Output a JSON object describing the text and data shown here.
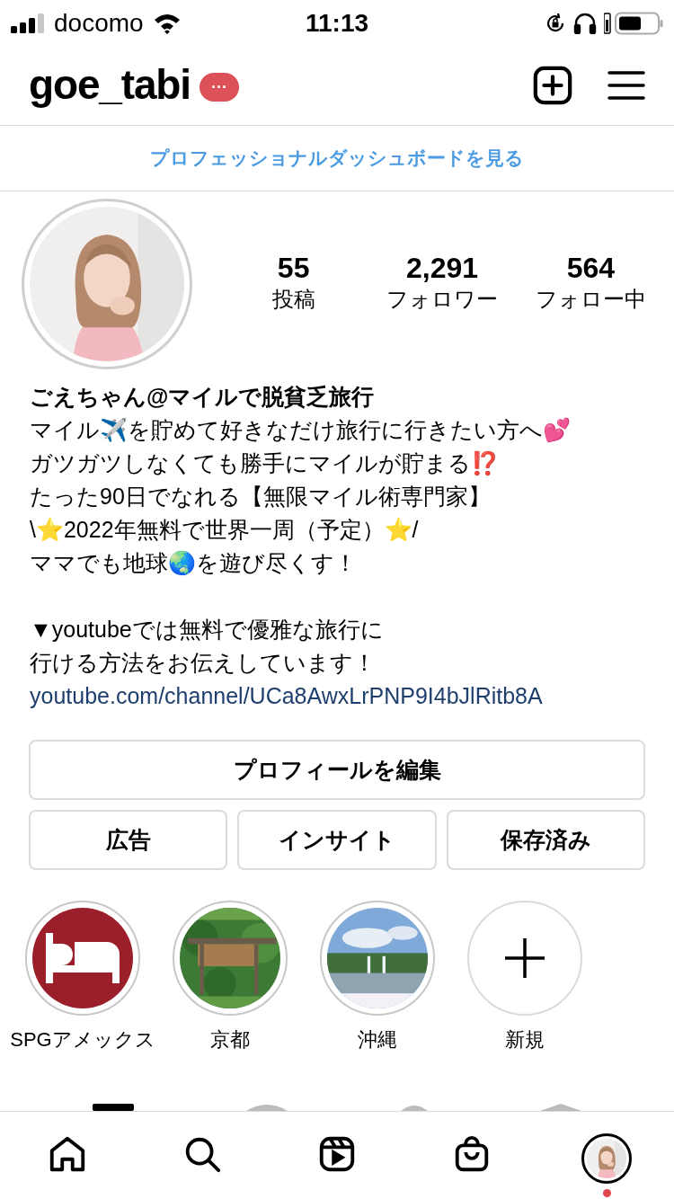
{
  "status_bar": {
    "carrier": "docomo",
    "time": "11:13"
  },
  "header": {
    "username": "goe_tabi",
    "badge": "···"
  },
  "dashboard_link": "プロフェッショナルダッシュボードを見る",
  "stats": [
    {
      "value": "55",
      "label": "投稿"
    },
    {
      "value": "2,291",
      "label": "フォロワー"
    },
    {
      "value": "564",
      "label": "フォロー中"
    }
  ],
  "bio": {
    "name": "ごえちゃん@マイルで脱貧乏旅行",
    "paragraphs": [
      [
        "マイル✈️を貯めて好きなだけ旅行に行きたい方へ💕",
        "ガツガツしなくても勝手にマイルが貯まる⁉️",
        "たった90日でなれる【無限マイル術専門家】",
        "\\⭐2022年無料で世界一周（予定）⭐/",
        "ママでも地球🌏を遊び尽くす！"
      ],
      [
        "▼youtubeでは無料で優雅な旅行に",
        "行ける方法をお伝えしています！"
      ]
    ],
    "link": "youtube.com/channel/UCa8AwxLrPNP9I4bJlRitb8A"
  },
  "edit_button": "プロフィールを編集",
  "action_buttons": [
    "広告",
    "インサイト",
    "保存済み"
  ],
  "highlights": [
    {
      "kind": "bed",
      "label": "SPGアメックス"
    },
    {
      "kind": "picture",
      "label": "京都"
    },
    {
      "kind": "picture",
      "label": "沖縄"
    },
    {
      "kind": "new",
      "label": "新規"
    }
  ],
  "bottom_nav": [
    {
      "kind": "home",
      "selected": false
    },
    {
      "kind": "search",
      "selected": false
    },
    {
      "kind": "reels",
      "selected": false
    },
    {
      "kind": "shop",
      "selected": false
    },
    {
      "kind": "profile",
      "selected": true,
      "notification": true
    }
  ]
}
